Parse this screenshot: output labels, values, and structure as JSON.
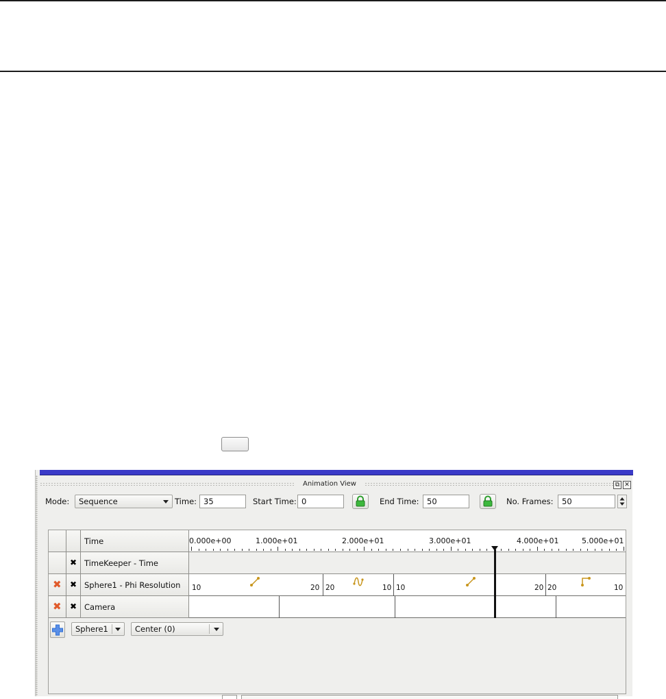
{
  "animation_view": {
    "title": "Animation View",
    "title_buttons": {
      "float_icon": "restore-window-icon",
      "close_icon": "close-icon"
    },
    "toolbar": {
      "mode_label": "Mode:",
      "mode_value": "Sequence",
      "time_label": "Time:",
      "time_value": "35",
      "start_time_label": "Start Time:",
      "start_time_value": "0",
      "end_time_label": "End Time:",
      "end_time_value": "50",
      "no_frames_label": "No. Frames:",
      "no_frames_value": "50",
      "lock_icon": "lock-icon",
      "lock_color": "#2e9e2e"
    },
    "timeline": {
      "header_label": "Time",
      "tick_labels": [
        "0.000e+00",
        "1.000e+01",
        "2.000e+01",
        "3.000e+01",
        "4.000e+01",
        "5.000e+01"
      ],
      "current_time": 35,
      "start": 0,
      "end": 50
    },
    "tracks": [
      {
        "name": "TimeKeeper - Time",
        "deletable": false,
        "enabled": true
      },
      {
        "name": "Sphere1 - Phi Resolution",
        "deletable": true,
        "enabled": true,
        "keyframes": [
          {
            "start_value": "10",
            "end_value": "20",
            "interp_icon": "linear-interpolation-icon"
          },
          {
            "start_value": "20",
            "end_value": "10",
            "interp_icon": "sinusoid-interpolation-icon"
          },
          {
            "start_value": "10",
            "end_value": "20",
            "interp_icon": "linear-interpolation-icon"
          },
          {
            "start_value": "20",
            "end_value": "10",
            "interp_icon": "step-interpolation-icon"
          }
        ]
      },
      {
        "name": "Camera",
        "deletable": true,
        "enabled": true
      }
    ],
    "add_row": {
      "add_icon": "plus-icon",
      "source_value": "Sphere1",
      "property_value": "Center (0)"
    },
    "colors": {
      "delete_icon": "#e05a2a",
      "add_icon": "#2f6fd6",
      "keyframe_icon": "#c8961e",
      "time_marker": "#111111",
      "dock_bar": "#3a3ac8"
    }
  }
}
